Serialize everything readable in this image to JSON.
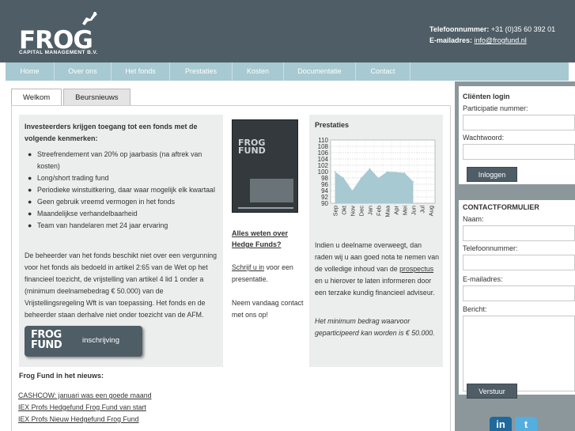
{
  "header": {
    "logo_text": "FROG",
    "logo_subtitle": "CAPITAL MANAGEMENT B.V.",
    "phone_label": "Telefoonnummer:",
    "phone_value": "+31 (0)35 60 392 01",
    "email_label": "E-mailadres:",
    "email_value": "info@frogfund.nl"
  },
  "nav": {
    "items": [
      {
        "label": "Home"
      },
      {
        "label": "Over ons"
      },
      {
        "label": "Het fonds"
      },
      {
        "label": "Prestaties"
      },
      {
        "label": "Kosten"
      },
      {
        "label": "Documentatie"
      },
      {
        "label": "Contact"
      }
    ]
  },
  "tabs": [
    {
      "label": "Welkom",
      "active": true
    },
    {
      "label": "Beursnieuws",
      "active": false
    }
  ],
  "main": {
    "intro": "Investeerders krijgen toegang tot een fonds met de volgende kenmerken:",
    "features": [
      "Streefrendement van 20% op jaarbasis (na aftrek van kosten)",
      "Long/short trading fund",
      "Periodieke winstuitkering, daar waar mogelijk elk kwartaal",
      "Geen gebruik vreemd vermogen in het fonds",
      "Maandelijkse verhandelbaarheid",
      "Team van handelaren met 24 jaar ervaring"
    ],
    "body": "De beheerder van het fonds beschikt niet over een vergunning voor het fonds als bedoeld in artikel 2:65 van de Wet op het financieel toezicht, de vrijstelling van artikel 4 lid 1 onder a (minimum deelnamebedrag € 50.000) van de Vrijstellingsregeling Wft is van toepassing. Het fonds en de beheerder staan derhalve niet onder toezicht van de AFM.",
    "button_brand": "FROG FUND",
    "button_label": "inschrijving",
    "book_title": "FROG FUND",
    "mid_link": "Alles weten over Hedge Funds?",
    "mid_text_link": "Schrijf u in",
    "mid_text_rest": " voor een presentatie.",
    "mid_text2": "Neem vandaag contact met ons op!",
    "prestaties_title": "Prestaties",
    "right_text_1": "Indien u deelname overweegt, dan raden wij u aan goed nota te nemen van de volledige inhoud van de ",
    "right_text_link": "prospectus",
    "right_text_2": " en u hierover te laten informeren door een terzake kundig financieel adviseur.",
    "right_italic": "Het minimum bedrag waarvoor geparticipeerd kan worden is € 50.000.",
    "news_title": "Frog Fund in het nieuws:",
    "news": [
      "CASHCOW: januari was een goede maand",
      "IEX Profs Hedgefund Frog Fund van start",
      "IEX Profs Nieuw Hedgefund Frog Fund"
    ]
  },
  "chart_data": {
    "type": "area",
    "categories": [
      "Sep",
      "Okt",
      "Nov",
      "Dec",
      "Jan",
      "Feb",
      "Maa",
      "Apr",
      "Mei",
      "Jun",
      "Jul",
      "Aug"
    ],
    "values": [
      100,
      98,
      94,
      98,
      101,
      98,
      100,
      99.8,
      99.6,
      96.8,
      null,
      null
    ],
    "ylim": [
      90,
      110
    ],
    "yticks": [
      90,
      92,
      94,
      96,
      98,
      100,
      102,
      104,
      106,
      108,
      110
    ],
    "grid": true,
    "colors": {
      "fill": "#a7c9d1",
      "grid": "#bbbbbb"
    }
  },
  "sidebar": {
    "login_title": "Cliënten login",
    "participant_label": "Participatie nummer:",
    "password_label": "Wachtwoord:",
    "login_button": "Inloggen",
    "contact_title": "CONTACTFORMULIER",
    "name_label": "Naam:",
    "phone_label": "Telefoonnummer:",
    "email_label": "E-mailadres:",
    "message_label": "Bericht:",
    "send_button": "Verstuur",
    "social": [
      {
        "name": "linkedin-icon",
        "glyph": "in",
        "color": "#1f6a9a"
      },
      {
        "name": "twitter-icon",
        "glyph": "t",
        "color": "#55aee0"
      }
    ]
  },
  "colors": {
    "header": "#4e5d66",
    "nav": "#a7c9d1",
    "sidebar": "#8c979c",
    "panel": "#eceeed"
  }
}
